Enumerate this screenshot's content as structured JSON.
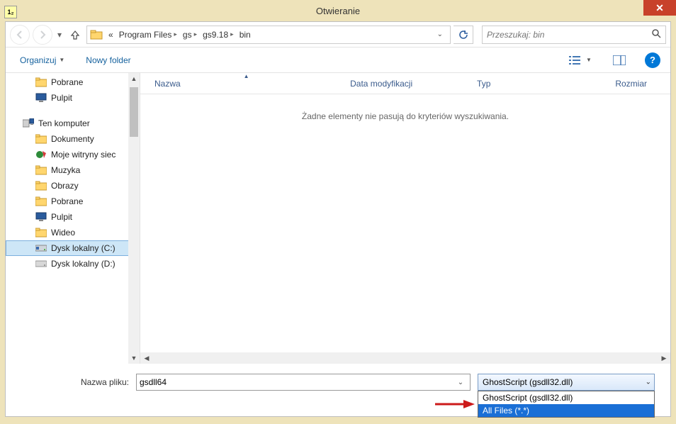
{
  "title": "Otwieranie",
  "nav": {
    "breadcrumb_prefix": "«",
    "crumbs": [
      "Program Files",
      "gs",
      "gs9.18",
      "bin"
    ],
    "search_placeholder": "Przeszukaj: bin"
  },
  "toolbar": {
    "organize": "Organizuj",
    "new_folder": "Nowy folder"
  },
  "tree": {
    "items": [
      {
        "label": "Pobrane",
        "level": 1,
        "icon": "folder"
      },
      {
        "label": "Pulpit",
        "level": 1,
        "icon": "monitor-small"
      },
      {
        "gap": true
      },
      {
        "label": "Ten komputer",
        "level": 0,
        "icon": "pc"
      },
      {
        "label": "Dokumenty",
        "level": 1,
        "icon": "folder"
      },
      {
        "label": "Moje witryny siec",
        "level": 1,
        "icon": "web"
      },
      {
        "label": "Muzyka",
        "level": 1,
        "icon": "folder"
      },
      {
        "label": "Obrazy",
        "level": 1,
        "icon": "folder"
      },
      {
        "label": "Pobrane",
        "level": 1,
        "icon": "folder"
      },
      {
        "label": "Pulpit",
        "level": 1,
        "icon": "monitor-small"
      },
      {
        "label": "Wideo",
        "level": 1,
        "icon": "folder"
      },
      {
        "label": "Dysk lokalny (C:)",
        "level": 1,
        "icon": "disk",
        "selected": true
      },
      {
        "label": "Dysk lokalny (D:)",
        "level": 1,
        "icon": "disk-gray"
      }
    ]
  },
  "columns": {
    "name": "Nazwa",
    "date": "Data modyfikacji",
    "type": "Typ",
    "size": "Rozmiar"
  },
  "empty_message": "Żadne elementy nie pasują do kryteriów wyszukiwania.",
  "footer": {
    "filename_label": "Nazwa pliku:",
    "filename_value": "gsdll64",
    "filter_selected": "GhostScript (gsdll32.dll)",
    "filter_options": [
      "GhostScript (gsdll32.dll)",
      "All Files (*.*)"
    ]
  }
}
